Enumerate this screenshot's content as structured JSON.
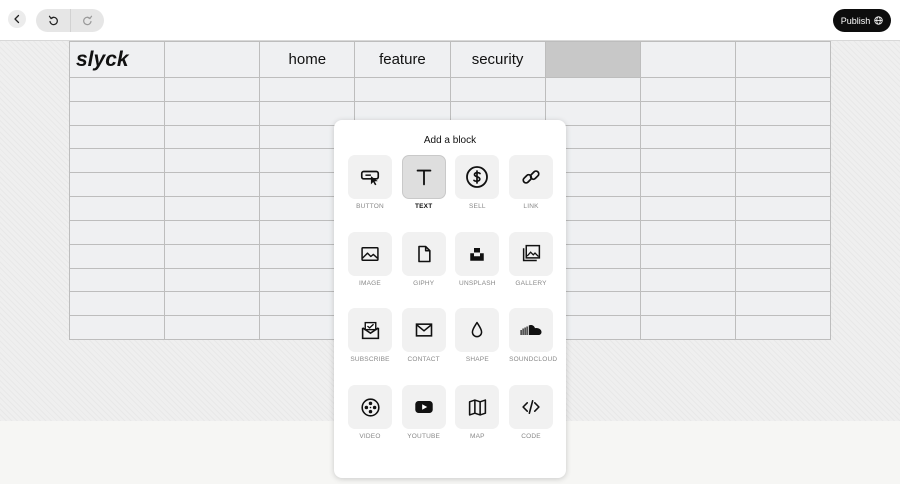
{
  "toolbar": {
    "publish_label": "Publish"
  },
  "site": {
    "logo": "slyck",
    "nav": [
      "home",
      "feature",
      "security"
    ]
  },
  "panel": {
    "title": "Add a block",
    "blocks": [
      {
        "label": "BUTTON",
        "icon": "button-cursor-icon"
      },
      {
        "label": "TEXT",
        "icon": "text-t-icon",
        "active": true
      },
      {
        "label": "SELL",
        "icon": "dollar-circle-icon"
      },
      {
        "label": "LINK",
        "icon": "chain-link-icon"
      },
      {
        "label": "IMAGE",
        "icon": "image-icon"
      },
      {
        "label": "GIPHY",
        "icon": "file-icon"
      },
      {
        "label": "UNSPLASH",
        "icon": "unsplash-icon"
      },
      {
        "label": "GALLERY",
        "icon": "gallery-icon"
      },
      {
        "label": "SUBSCRIBE",
        "icon": "subscribe-icon"
      },
      {
        "label": "CONTACT",
        "icon": "envelope-icon"
      },
      {
        "label": "SHAPE",
        "icon": "drop-icon"
      },
      {
        "label": "SOUNDCLOUD",
        "icon": "soundcloud-icon"
      },
      {
        "label": "VIDEO",
        "icon": "film-reel-icon"
      },
      {
        "label": "YOUTUBE",
        "icon": "youtube-icon"
      },
      {
        "label": "MAP",
        "icon": "map-icon"
      },
      {
        "label": "CODE",
        "icon": "code-icon"
      }
    ]
  }
}
